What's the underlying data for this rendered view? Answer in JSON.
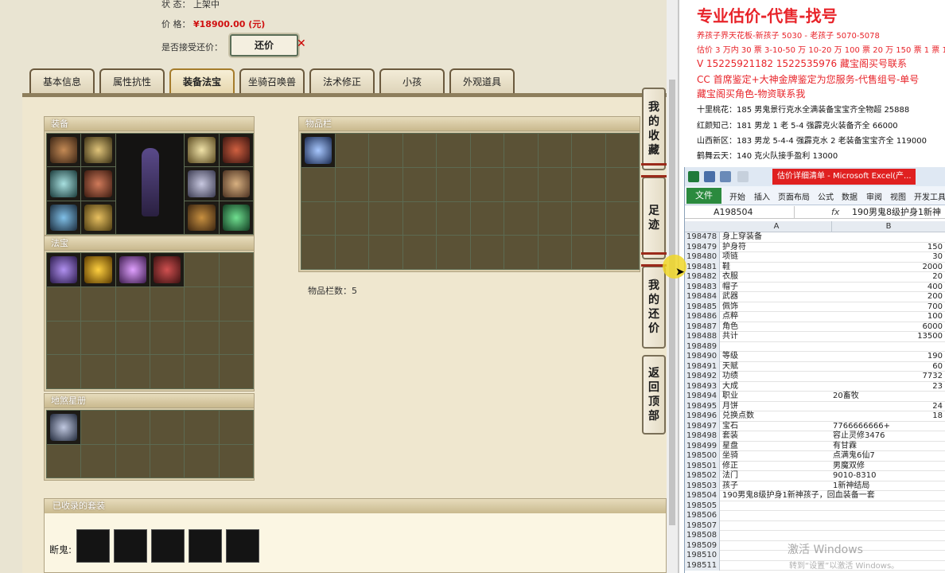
{
  "game": {
    "status_label": "状 态：",
    "status_value": "上架中",
    "price_label": "价 格：",
    "price_value": "¥18900.00 (元)",
    "counter_label": "是否接受还价：",
    "counter_button": "还价",
    "tabs": [
      "基本信息",
      "属性抗性",
      "装备法宝",
      "坐骑召唤兽",
      "法术修正",
      "小孩",
      "外观道具"
    ],
    "equip_title": "装备",
    "fabao_title": "法宝",
    "star_title": "地煞星册",
    "inventory_title": "物品栏",
    "inventory_count": "物品栏数：5",
    "suit_title": "已收录的套装",
    "suit_label": "断鬼:",
    "side_buttons": [
      [
        "我",
        "的",
        "收",
        "藏"
      ],
      [
        "足",
        "迹"
      ],
      [
        "我",
        "的",
        "还",
        "价"
      ],
      [
        "返",
        "回",
        "顶",
        "部"
      ]
    ]
  },
  "notes": {
    "title": "专业估价-代售-找号",
    "line1": "养孩子界天花板-新孩子 5030 - 老孩子 5070-5078",
    "line2": "估价 3 万内 30 票 3-10-50 万 10-20 万 100 票 20 万 150 票 1 票 1",
    "line3": "V 15225921182   1522535976   藏宝阁买号联系",
    "line4": "CC 首席鉴定+大神金牌鉴定为您服务-代售组号-单号",
    "line5": "藏宝阁买角色-物资联系我",
    "entries": [
      "十里桃花：185 男鬼景行克水全满装备宝宝齐全物超 25888",
      "红颜知己：181 男龙 1 老 5-4 强霹克火装备齐全 66000",
      "山西新区：183 男龙 5-4-4 强霹克水 2 老装备宝宝齐全 119000",
      "鹤舞云天：140 克火队接手盈利 13000"
    ]
  },
  "excel": {
    "window_title": "估价详细清单 - Microsoft Excel(产...",
    "file_tab": "文件",
    "ribbon_tabs": [
      "开始",
      "插入",
      "页面布局",
      "公式",
      "数据",
      "审阅",
      "视图",
      "开发工具"
    ],
    "name_box": "A198504",
    "formula": "190男鬼8级护身1新神",
    "col_a": "A",
    "col_b": "B",
    "rows": [
      {
        "n": "198478",
        "a": "身上穿装备",
        "b": "",
        "num": false
      },
      {
        "n": "198479",
        "a": "护身符",
        "b": "150",
        "num": true
      },
      {
        "n": "198480",
        "a": "项链",
        "b": "30",
        "num": true
      },
      {
        "n": "198481",
        "a": "鞋",
        "b": "2000",
        "num": true
      },
      {
        "n": "198482",
        "a": "衣服",
        "b": "20",
        "num": true
      },
      {
        "n": "198483",
        "a": "帽子",
        "b": "400",
        "num": true
      },
      {
        "n": "198484",
        "a": "武器",
        "b": "200",
        "num": true
      },
      {
        "n": "198485",
        "a": "佩饰",
        "b": "700",
        "num": true
      },
      {
        "n": "198486",
        "a": "点粹",
        "b": "100",
        "num": true
      },
      {
        "n": "198487",
        "a": "角色",
        "b": "6000",
        "num": true
      },
      {
        "n": "198488",
        "a": "共计",
        "b": "13500",
        "num": true
      },
      {
        "n": "198489",
        "a": "",
        "b": "",
        "num": false
      },
      {
        "n": "198490",
        "a": "等级",
        "b": "190",
        "num": true
      },
      {
        "n": "198491",
        "a": "天赋",
        "b": "60",
        "num": true
      },
      {
        "n": "198492",
        "a": "功绩",
        "b": "7732",
        "num": true
      },
      {
        "n": "198493",
        "a": "大成",
        "b": "23",
        "num": true
      },
      {
        "n": "198494",
        "a": "职业",
        "b": "20畜牧",
        "num": false
      },
      {
        "n": "198495",
        "a": "月饼",
        "b": "24",
        "num": true
      },
      {
        "n": "198496",
        "a": "兑换点数",
        "b": "18",
        "num": true
      },
      {
        "n": "198497",
        "a": "宝石",
        "b": "7766666666+",
        "num": false
      },
      {
        "n": "198498",
        "a": "套装",
        "b": "容止灵修3476",
        "num": false
      },
      {
        "n": "198499",
        "a": "星盘",
        "b": "有甘霖",
        "num": false
      },
      {
        "n": "198500",
        "a": "坐骑",
        "b": "点满鬼6仙7",
        "num": false
      },
      {
        "n": "198501",
        "a": "修正",
        "b": "男魔双修",
        "num": false
      },
      {
        "n": "198502",
        "a": "法门",
        "b": "9010-8310",
        "num": false
      },
      {
        "n": "198503",
        "a": "孩子",
        "b": "1新神结局",
        "num": false
      },
      {
        "n": "198504",
        "a": "190男鬼8级护身1新神孩子，回血装备一套",
        "b": "",
        "num": false
      },
      {
        "n": "198505",
        "a": "",
        "b": "",
        "num": false
      },
      {
        "n": "198506",
        "a": "",
        "b": "",
        "num": false
      },
      {
        "n": "198507",
        "a": "",
        "b": "",
        "num": false
      },
      {
        "n": "198508",
        "a": "",
        "b": "",
        "num": false
      },
      {
        "n": "198509",
        "a": "",
        "b": "",
        "num": false
      },
      {
        "n": "198510",
        "a": "",
        "b": "",
        "num": false
      },
      {
        "n": "198511",
        "a": "",
        "b": "",
        "num": false
      }
    ]
  },
  "watermark": {
    "line1": "激活 Windows",
    "line2": "转到“设置”以激活 Windows。"
  },
  "colors": {
    "price_red": "#d01010",
    "notes_red": "#e8242a",
    "excel_file_green": "#2b8a3e",
    "panel_bg": "#d8ccaa",
    "slot_bg": "#5b5236"
  }
}
